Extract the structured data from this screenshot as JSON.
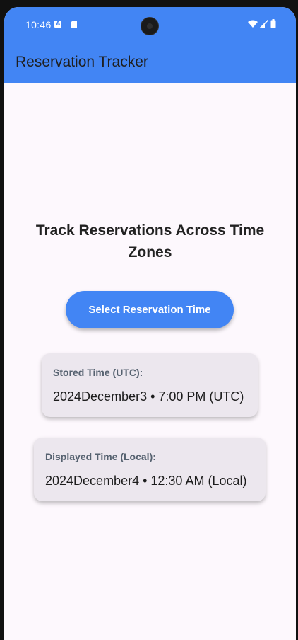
{
  "status_bar": {
    "time": "10:46",
    "icons": [
      "a-notification-icon",
      "sd-card-icon",
      "camera-cutout",
      "wifi-icon",
      "signal-icon",
      "battery-icon"
    ]
  },
  "app_bar": {
    "title": "Reservation Tracker",
    "color": "#4285f4"
  },
  "main": {
    "headline": "Track Reservations Across Time Zones",
    "select_button_label": "Select Reservation Time",
    "stored_card": {
      "label": "Stored Time (UTC):",
      "value": "2024December3 • 7:00 PM (UTC)"
    },
    "displayed_card": {
      "label": "Displayed Time (Local):",
      "value": "2024December4 • 12:30 AM (Local)"
    }
  }
}
